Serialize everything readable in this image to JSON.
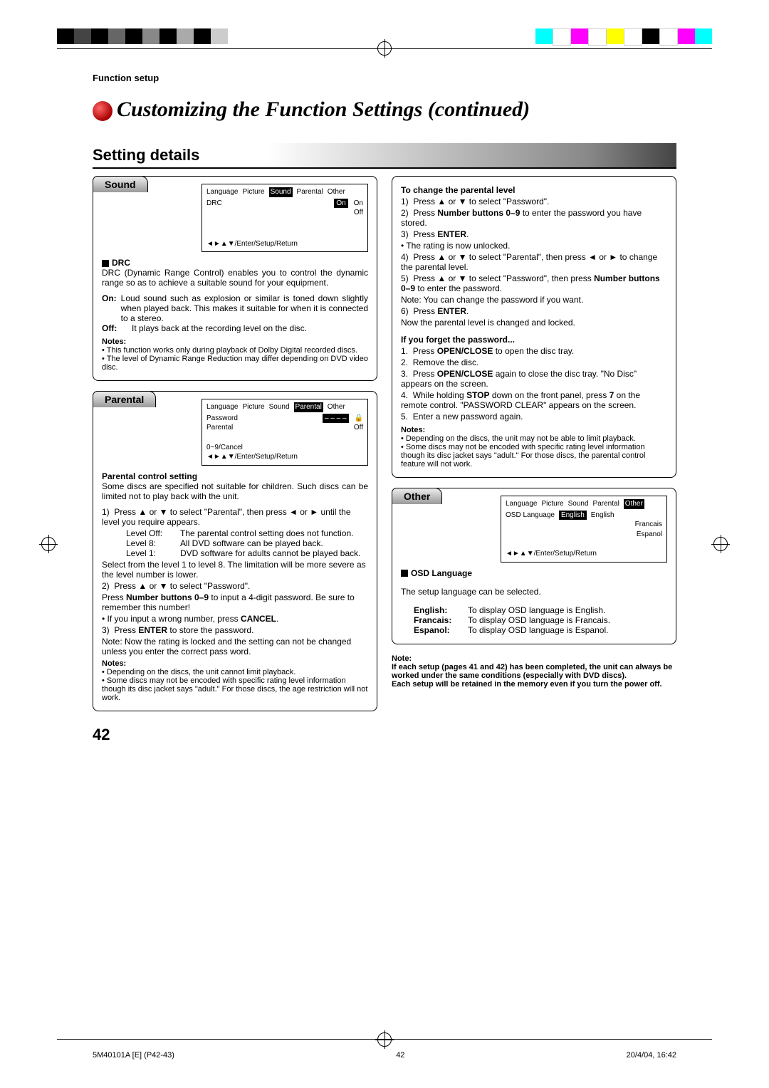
{
  "header": {
    "section_label": "Function setup"
  },
  "title": "Customizing the Function Settings (continued)",
  "heading": "Setting details",
  "sound": {
    "tab": "Sound",
    "menu": {
      "tabs": [
        "Language",
        "Picture",
        "Sound",
        "Parental",
        "Other"
      ],
      "selected": "Sound",
      "item": "DRC",
      "value": "On",
      "options": [
        "On",
        "Off"
      ],
      "footer": "◄►▲▼/Enter/Setup/Return"
    },
    "drc_title": "DRC",
    "drc_desc": "DRC (Dynamic Range Control) enables you to control the dynamic range so as to achieve a suitable sound for your equipment.",
    "on_label": "On:",
    "on_text": "Loud sound such as explosion or similar is toned down slightly when played back. This makes it suitable for when it is connected to a stereo.",
    "off_label": "Off:",
    "off_text": "It plays back at the recording level on the disc.",
    "notes_label": "Notes:",
    "notes": [
      "This function works only during playback of Dolby Digital recorded discs.",
      "The level of Dynamic Range Reduction may differ depending on DVD video disc."
    ]
  },
  "parental": {
    "tab": "Parental",
    "menu": {
      "tabs": [
        "Language",
        "Picture",
        "Sound",
        "Parental",
        "Other"
      ],
      "selected": "Parental",
      "password_label": "Password",
      "password_value": "– – – –",
      "parental_label": "Parental",
      "parental_value": "Off",
      "hint": "0~9/Cancel",
      "footer": "◄►▲▼/Enter/Setup/Return"
    },
    "pcs_title": "Parental control setting",
    "pcs_desc": "Some discs are specified not suitable for children. Such discs can be limited not to play back with the unit.",
    "step1a": "Press ▲ or ▼ to select \"Parental\", then press ◄ or ► until the level you require appears.",
    "lvl_off_l": "Level Off:",
    "lvl_off_t": "The parental control setting does not function.",
    "lvl_8_l": "Level 8:",
    "lvl_8_t": "All DVD software can be played back.",
    "lvl_1_l": "Level 1:",
    "lvl_1_t": "DVD software for adults cannot be played back.",
    "step1b": "Select from the level 1 to level 8. The limitation will be more severe as the level number is lower.",
    "step2a": "Press ▲ or ▼ to select \"Password\".",
    "step2b_pre": "Press ",
    "step2b_bold": "Number buttons 0–9",
    "step2b_post": " to input a 4-digit password. Be sure to remember this number!",
    "step2c_pre": "• If you input a wrong number, press ",
    "step2c_bold": "CANCEL",
    "step2c_post": ".",
    "step3a_pre": "Press ",
    "step3a_bold": "ENTER",
    "step3a_post": " to store the password.",
    "step3b": "Note: Now the rating is locked and the setting can not be changed unless you enter the correct pass word.",
    "notes_label": "Notes:",
    "notes": [
      "Depending on the discs, the unit cannot limit playback.",
      "Some discs may not be encoded with specific rating level information though its disc jacket says \"adult.\" For those discs, the age restriction will not work."
    ]
  },
  "right": {
    "chg_title": "To change the parental level",
    "s1": "Press ▲ or ▼ to select \"Password\".",
    "s2_pre": "Press ",
    "s2_bold": "Number buttons 0–9",
    "s2_post": " to enter the password you have stored.",
    "s3_pre": "Press ",
    "s3_bold": "ENTER",
    "s3_post": ".",
    "s3_note": "• The rating is now unlocked.",
    "s4": "Press ▲ or ▼ to select \"Parental\", then press ◄ or ► to change the parental level.",
    "s5_a": "Press ▲ or ▼ to select \"Password\", then press",
    "s5_bold": "Number buttons 0–9",
    "s5_b": " to enter the password.",
    "s5_note": "Note: You can change the password if you want.",
    "s6_pre": "Press ",
    "s6_bold": "ENTER",
    "s6_post": ".",
    "s6_note": "Now the parental level is changed and locked.",
    "forget_title": "If you forget the password...",
    "f1_pre": "Press ",
    "f1_bold": "OPEN/CLOSE",
    "f1_post": " to open the disc tray.",
    "f2": "Remove the disc.",
    "f3_pre": "Press ",
    "f3_bold": "OPEN/CLOSE",
    "f3_post": " again to close the disc tray. \"No Disc\" appears on the screen.",
    "f4_a": "While holding ",
    "f4_bold1": "STOP",
    "f4_b": " down on the front panel, press ",
    "f4_bold2": "7",
    "f4_c": " on the remote control. \"PASSWORD CLEAR\" appears on the screen.",
    "f5": "Enter a new password again.",
    "notes_label": "Notes:",
    "notes": [
      "Depending on the discs, the unit may not be able to limit playback.",
      "Some discs may not be encoded with specific rating level information though its disc jacket says \"adult.\" For those discs, the parental control feature will not work."
    ]
  },
  "other": {
    "tab": "Other",
    "menu": {
      "tabs": [
        "Language",
        "Picture",
        "Sound",
        "Parental",
        "Other"
      ],
      "selected": "Other",
      "item": "OSD Language",
      "value": "English",
      "options": [
        "English",
        "Francais",
        "Espanol"
      ],
      "footer": "◄►▲▼/Enter/Setup/Return"
    },
    "osd_title": "OSD Language",
    "osd_desc": "The setup language can be selected.",
    "eng_l": "English:",
    "eng_t": "To display OSD language is English.",
    "fra_l": "Francais:",
    "fra_t": "To display OSD language is Francais.",
    "esp_l": "Espanol:",
    "esp_t": "To display OSD language is Espanol."
  },
  "footnote": {
    "note_l": "Note:",
    "note_t1": "If each setup (pages 41 and 42) has been completed, the unit can always be worked under the same conditions (especially with DVD discs).",
    "note_t2": "Each setup will be retained in the memory even if you turn the power off."
  },
  "pagenum": "42",
  "footer": {
    "left": "5M40101A [E] (P42-43)",
    "mid": "42",
    "right": "20/4/04, 16:42"
  }
}
